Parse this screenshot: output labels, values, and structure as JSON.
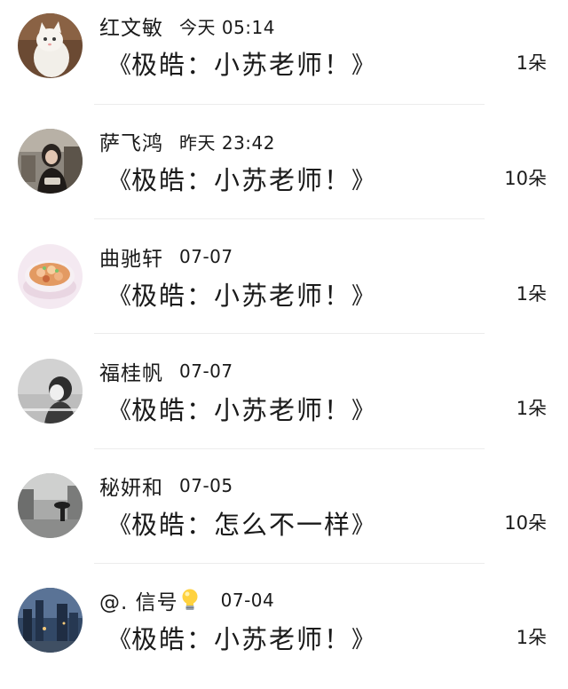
{
  "comments": [
    {
      "user": "红文敏",
      "emoji": "",
      "time": "今天 05:14",
      "open_bracket": "《",
      "message": "极皓：小苏老师！",
      "close_bracket": "》",
      "count": "1朵",
      "avatar_icon": "white-cat-avatar"
    },
    {
      "user": "萨飞鸿",
      "emoji": "",
      "time": "昨天 23:42",
      "open_bracket": "《",
      "message": "极皓：小苏老师！",
      "close_bracket": "》",
      "count": "10朵",
      "avatar_icon": "girl-photo-avatar"
    },
    {
      "user": "曲驰轩",
      "emoji": "",
      "time": "07-07",
      "open_bracket": "《",
      "message": "极皓：小苏老师！",
      "close_bracket": "》",
      "count": "1朵",
      "avatar_icon": "soup-bowl-avatar"
    },
    {
      "user": "福桂帆",
      "emoji": "",
      "time": "07-07",
      "open_bracket": "《",
      "message": "极皓：小苏老师！",
      "close_bracket": "》",
      "count": "1朵",
      "avatar_icon": "sketch-girl-avatar"
    },
    {
      "user": "秘妍和",
      "emoji": "",
      "time": "07-05",
      "open_bracket": "《",
      "message": "极皓：怎么不一样",
      "close_bracket": "》",
      "count": "10朵",
      "avatar_icon": "rainy-street-avatar"
    },
    {
      "user": "@. 信号",
      "emoji": "lightbulb-icon",
      "time": "07-04",
      "open_bracket": "《",
      "message": "极皓：小苏老师！",
      "close_bracket": "》",
      "count": "1朵",
      "avatar_icon": "city-night-avatar"
    }
  ]
}
